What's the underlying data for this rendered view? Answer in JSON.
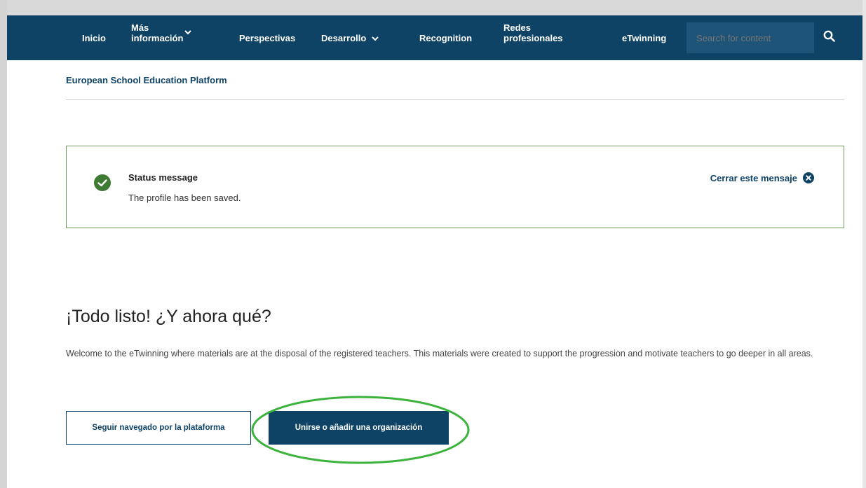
{
  "nav": {
    "items": [
      {
        "label": "Inicio"
      },
      {
        "label": "Más información"
      },
      {
        "label": "Perspectivas"
      },
      {
        "label": "Desarrollo"
      },
      {
        "label": "Recognition"
      },
      {
        "label": "Redes profesionales"
      },
      {
        "label": "eTwinning"
      }
    ],
    "search_placeholder": "Search for content"
  },
  "site_name": "European School Education Platform",
  "status": {
    "title": "Status message",
    "text": "The profile has been saved.",
    "close_label": "Cerrar este mensaje"
  },
  "main": {
    "heading": "¡Todo listo! ¿Y ahora qué?",
    "welcome": "Welcome to the eTwinning where materials are at the disposal of the registered teachers. This materials were created to support the progression and motivate teachers to go deeper in all areas.",
    "btn_continue": "Seguir navegado por la plataforma",
    "btn_join": "Unirse o añadir una organización"
  },
  "colors": {
    "nav_bg": "#0e4365",
    "success": "#3f7a32",
    "highlight": "#3cb33c"
  }
}
